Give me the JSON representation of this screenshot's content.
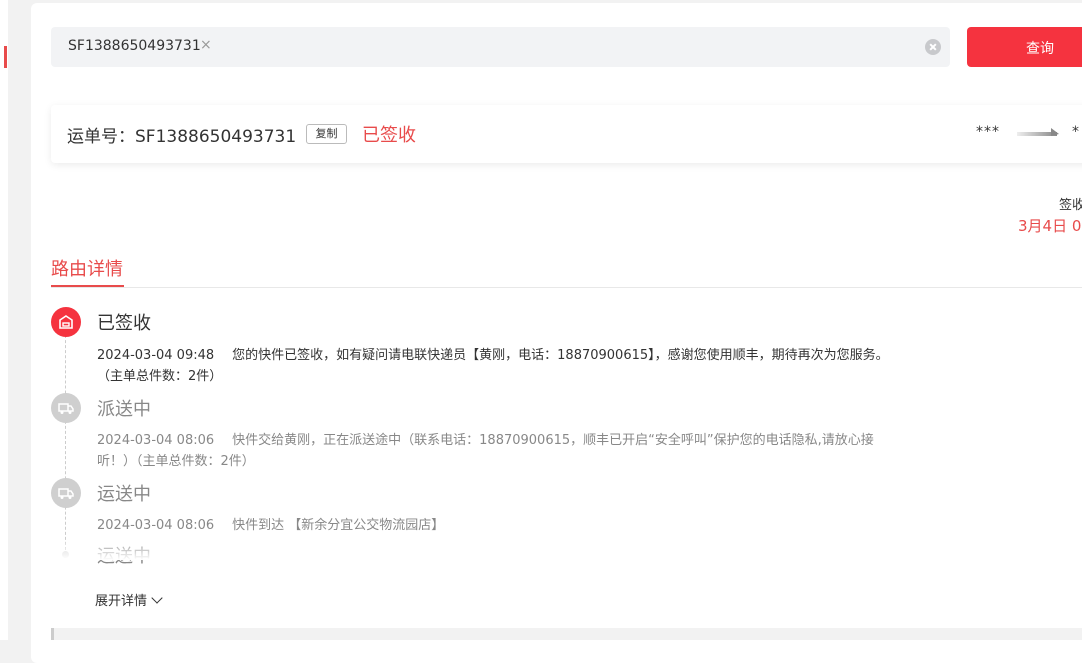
{
  "search": {
    "tag_value": "SF1388650493731",
    "tag_remove": "×",
    "query_button": "查询"
  },
  "waybill": {
    "label": "运单号：SF1388650493731",
    "copy": "复制",
    "status": "已签收",
    "route_from": "***",
    "route_to": "*"
  },
  "sign": {
    "label": "签收",
    "date": "3月4日 0"
  },
  "section": {
    "title": "路由详情"
  },
  "timeline": [
    {
      "status": "已签收",
      "time": "2024-03-04 09:48",
      "desc": "您的快件已签收，如有疑问请电联快递员【黄刚，电话：18870900615】，感谢您使用顺丰，期待再次为您服务。",
      "desc2": "（主单总件数：2件）",
      "icon": "signed-icon",
      "active": true
    },
    {
      "status": "派送中",
      "time": "2024-03-04 08:06",
      "desc": "快件交给黄刚，正在派送途中（联系电话：18870900615，顺丰已开启“安全呼叫”保护您的电话隐私,请放心接",
      "desc2": "听！）（主单总件数：2件）",
      "icon": "truck-icon",
      "active": false
    },
    {
      "status": "运送中",
      "time": "2024-03-04 08:06",
      "desc": "快件到达 【新余分宜公交物流园店】",
      "icon": "truck-icon",
      "active": false
    },
    {
      "status": "运送中",
      "icon": "dot",
      "active": false
    }
  ],
  "expand": {
    "label": "展开详情"
  },
  "colors": {
    "accent": "#f5333f",
    "status_red": "#e84b4b",
    "inactive_icon": "#cfcfcf"
  }
}
